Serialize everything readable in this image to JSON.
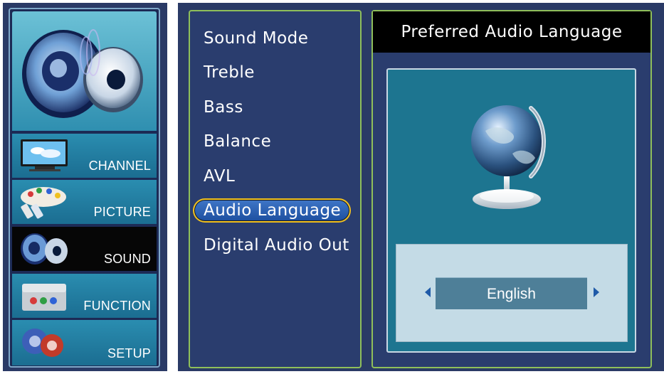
{
  "sidebar": {
    "hero_icon": "speaker-icon",
    "categories": [
      {
        "label": "CHANNEL",
        "icon": "tv-icon",
        "active": false
      },
      {
        "label": "PICTURE",
        "icon": "paint-palette-icon",
        "active": false
      },
      {
        "label": "SOUND",
        "icon": "speaker-icon",
        "active": true
      },
      {
        "label": "FUNCTION",
        "icon": "toolbox-icon",
        "active": false
      },
      {
        "label": "SETUP",
        "icon": "gears-icon",
        "active": false
      }
    ]
  },
  "menu": {
    "items": [
      {
        "label": "Sound Mode"
      },
      {
        "label": "Treble"
      },
      {
        "label": "Bass"
      },
      {
        "label": "Balance"
      },
      {
        "label": "AVL"
      },
      {
        "label": "Audio Language",
        "selected": true
      },
      {
        "label": "Digital Audio Out"
      }
    ]
  },
  "detail": {
    "title": "Preferred Audio Language",
    "illustration_icon": "globe-icon",
    "value": "English"
  },
  "colors": {
    "panel_bg": "#2a3a66",
    "panel_border": "#8fbf5a",
    "selection_ring": "#f0c020",
    "selection_fill": "#2a5fb0",
    "content_bg": "#1d7590",
    "selector_bg": "#c4dbe6",
    "value_bg": "#4e7f98",
    "arrow_color": "#1f5aa8"
  }
}
